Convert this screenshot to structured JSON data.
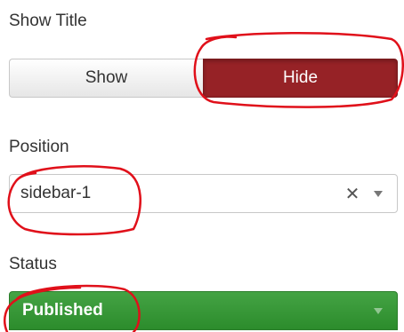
{
  "show_title": {
    "label": "Show Title",
    "options": [
      {
        "label": "Show",
        "selected": false
      },
      {
        "label": "Hide",
        "selected": true
      }
    ]
  },
  "position": {
    "label": "Position",
    "value": "sidebar-1",
    "clear_glyph": "✕"
  },
  "status": {
    "label": "Status",
    "value": "Published"
  },
  "colors": {
    "selected_toggle": "#962226",
    "status_published": "#3a9a3a",
    "annotation": "#e0101a"
  },
  "icons": [
    "clear-icon",
    "chevron-down-icon"
  ]
}
